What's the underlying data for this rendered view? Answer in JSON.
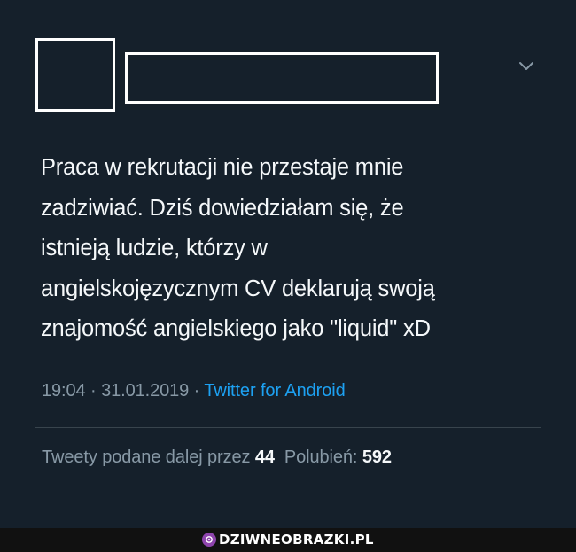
{
  "tweet": {
    "text": "Praca w rekrutacji nie przestaje mnie\nzadziwiać. Dziś dowiedziałam się, że\nistnieją ludzie, którzy w\nangielskojęzycznym CV deklarują swoją\nznajomość angielskiego jako \"liquid\" xD",
    "time": "19:04",
    "date": "31.01.2019",
    "separator": "·",
    "source": "Twitter for Android",
    "retweets_label": "Tweety podane dalej przez",
    "retweets_count": "44",
    "likes_label": "Polubień:",
    "likes_count": "592"
  },
  "icons": {
    "more": "chevron-down-icon"
  },
  "colors": {
    "background": "#15202b",
    "text": "#f5f8fa",
    "muted": "#8899a6",
    "link": "#1da1f2"
  },
  "watermark": {
    "text": "DZIWNEOBRAZKI.PL"
  }
}
